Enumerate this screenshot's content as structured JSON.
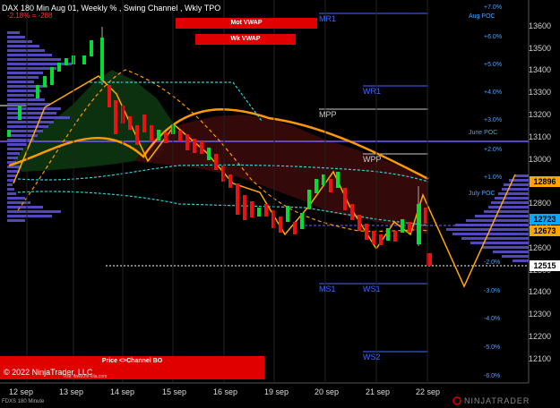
{
  "header": {
    "title": "DAX 180 Min Aug 01, Weekly % , Swing Channel , Wkly TPO",
    "change": "-2.18% = -288"
  },
  "badges": {
    "mot_vwap": "Mot VWAP",
    "wk_vwap": "Wk VWAP",
    "price_channel": "Price <>Channel BO",
    "copyright": "© 2022 NinjaTrader, LLC",
    "website": "Visit: www.fin-vila.com"
  },
  "footer": {
    "instrument": "FDXS 180 Minute",
    "brand": "NINJATRADER"
  },
  "levels": {
    "mr1": "MR1",
    "wr1": "WR1",
    "mpp": "MPP",
    "wpp": "WPP",
    "ms1": "MS1",
    "ws1": "WS1",
    "ws2": "WS2",
    "aug_poc": "Aug POC",
    "june_poc": "June POC",
    "july_poc": "July POC"
  },
  "percent_labels": [
    "+7.0%",
    "+6.0%",
    "+5.0%",
    "+4.0%",
    "+3.0%",
    "+2.0%",
    "+1.0%",
    "-2.0%",
    "-3.0%",
    "-4.0%",
    "-5.0%",
    "-6.0%"
  ],
  "price_axis": [
    "13600",
    "13500",
    "13400",
    "13300",
    "13200",
    "13100",
    "13000",
    "12900",
    "12800",
    "12700",
    "12600",
    "12500",
    "12400",
    "12300",
    "12200",
    "12100"
  ],
  "price_tags": {
    "tag1": "12896",
    "tag2": "12723",
    "tag3": "12673",
    "tag4": "12515"
  },
  "colors": {
    "up": "#00dd33",
    "down": "#ee1111",
    "tag_orange": "#ffa500",
    "tag_blue": "#00aaff",
    "pct_blue": "#4aa3ff",
    "poc_purple": "#7a5cff"
  },
  "x_axis": [
    "12 sep",
    "13 sep",
    "14 sep",
    "15 sep",
    "16 sep",
    "19 sep",
    "20 sep",
    "21 sep",
    "22 sep"
  ]
}
